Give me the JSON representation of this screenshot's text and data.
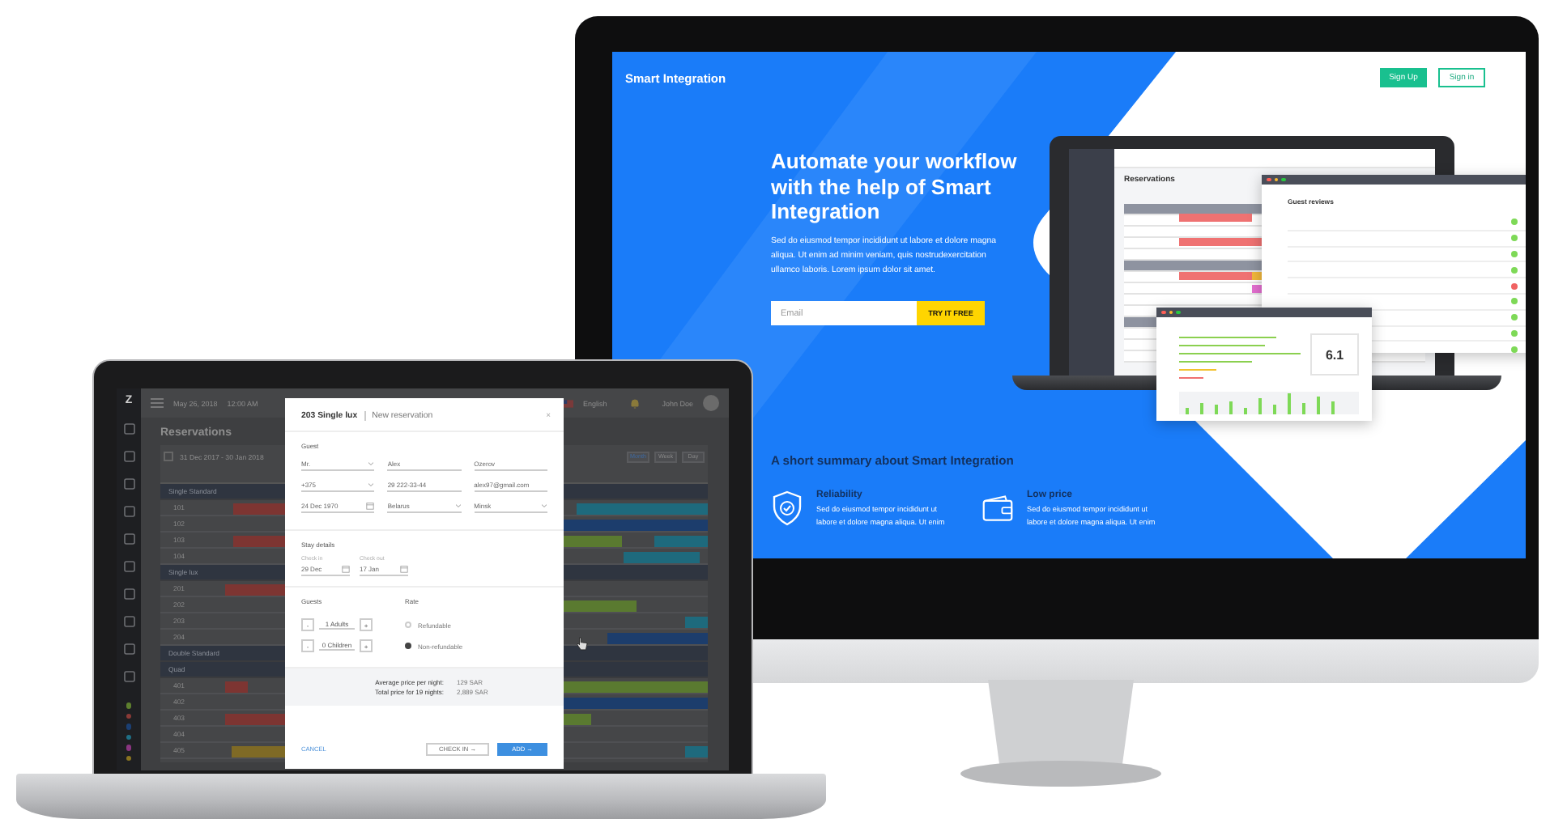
{
  "landing_page": {
    "brand": "Smart Integration",
    "nav_buttons": [
      {
        "label": "Sign Up",
        "kind": "filled"
      },
      {
        "label": "Sign in",
        "kind": "outline"
      }
    ],
    "hero": {
      "heading": "Automate your workflow with the help of Smart Integration",
      "text": "Sed do eiusmod tempor incididunt ut labore et dolore magna aliqua. Ut enim ad minim veniam, quis nostrudexercitation ullamco laboris. Lorem ipsum dolor sit amet.",
      "email_placeholder": "Email",
      "cta": "TRY IT FREE"
    },
    "summary": {
      "heading": "A short summary about Smart Integration",
      "features": [
        {
          "kind": "shield",
          "title": "Reliability",
          "text": "Sed do eiusmod tempor incididunt ut labore et dolore magna aliqua. Ut enim"
        },
        {
          "kind": "wallet",
          "title": "Low price",
          "text": "Sed do eiusmod tempor incididunt ut labore et dolore magna aliqua. Ut enim"
        }
      ]
    },
    "preview": {
      "page_title": "Reservations",
      "window_title": "Guest reviews",
      "score": "6.1"
    }
  },
  "reservation_app": {
    "logo": "Z",
    "date": "May 26, 2018",
    "time": "12:00 AM",
    "language": "English",
    "user": "John Doe",
    "page_title": "Reservations",
    "date_range": "31 Dec 2017 - 30 Jan 2018",
    "views": [
      {
        "label": "Month",
        "selected": true
      },
      {
        "label": "Week",
        "selected": false
      },
      {
        "label": "Day",
        "selected": false
      }
    ],
    "groups": [
      {
        "name": "Single Standard",
        "rooms": [
          "101",
          "102",
          "103",
          "104"
        ]
      },
      {
        "name": "Single lux",
        "rooms": [
          "201",
          "202",
          "203",
          "204"
        ]
      },
      {
        "name": "Double Standard"
      },
      {
        "name": "Quad",
        "rooms": [
          "401",
          "402",
          "403",
          "404",
          "405"
        ]
      }
    ],
    "legend": [
      {
        "color": "#5d7f2e"
      },
      {
        "color": "#8a3a36"
      },
      {
        "color": "#1b3f73"
      },
      {
        "color": "#1f6f85"
      },
      {
        "color": "#8a3580"
      },
      {
        "color": "#8a7420"
      }
    ],
    "modal": {
      "room": "203 Single lux",
      "title": "New reservation",
      "close": "×",
      "guest_label": "Guest",
      "fields": [
        [
          {
            "value": "Mr.",
            "kind": "select"
          },
          {
            "value": "Alex",
            "kind": "text"
          },
          {
            "value": "Ozerov",
            "kind": "text"
          }
        ],
        [
          {
            "value": "+375",
            "kind": "select"
          },
          {
            "value": "29 222-33-44",
            "kind": "text"
          },
          {
            "value": "alex97@gmail.com",
            "kind": "text"
          }
        ],
        [
          {
            "value": "24 Dec 1970",
            "kind": "date"
          },
          {
            "value": "Belarus",
            "kind": "select"
          },
          {
            "value": "Minsk",
            "kind": "select"
          }
        ]
      ],
      "stay_label": "Stay details",
      "dates": [
        {
          "label": "Check in",
          "value": "29 Dec"
        },
        {
          "label": "Check out",
          "value": "17 Jan"
        }
      ],
      "guests_label": "Guests",
      "counters": [
        {
          "decrement": "-",
          "value": "1 Adults",
          "increment": "+"
        },
        {
          "decrement": "-",
          "value": "0 Children",
          "increment": "+"
        }
      ],
      "rate_label": "Rate",
      "rates": [
        {
          "label": "Refundable",
          "selected": false
        },
        {
          "label": "Non-refundable",
          "selected": true
        }
      ],
      "prices": [
        {
          "label": "Average price per night:",
          "value": "129 SAR"
        },
        {
          "label": "Total price for 19 nights:",
          "value": "2,889 SAR"
        }
      ],
      "actions": [
        {
          "label": "CANCEL",
          "kind": "link"
        },
        {
          "label": "CHECK IN →",
          "kind": "outline"
        },
        {
          "label": "ADD →",
          "kind": "primary"
        }
      ]
    }
  }
}
